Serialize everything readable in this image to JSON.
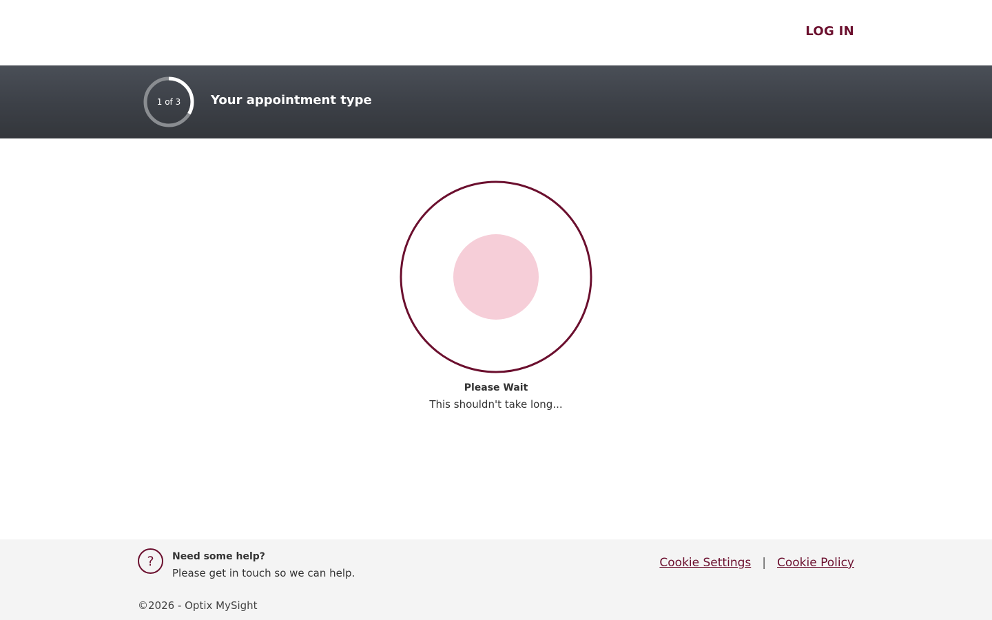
{
  "header": {
    "login_label": "LOG IN"
  },
  "steps": {
    "counter": "1 of 3",
    "title": "Your appointment type",
    "progress_fraction": 0.333
  },
  "loading": {
    "title": "Please Wait",
    "subtitle": "This shouldn't take long..."
  },
  "footer": {
    "help_icon": "question-icon",
    "help_glyph": "?",
    "help_title": "Need some help?",
    "help_text": "Please get in touch so we can help.",
    "cookie_settings_label": "Cookie Settings",
    "separator": "|",
    "cookie_policy_label": "Cookie Policy",
    "copyright": "©2026 - Optix MySight"
  },
  "colors": {
    "brand": "#6b0f2e",
    "loader_inner": "#f6ced8",
    "step_bar": "#3f434a",
    "footer_bg": "#f4f4f4"
  }
}
